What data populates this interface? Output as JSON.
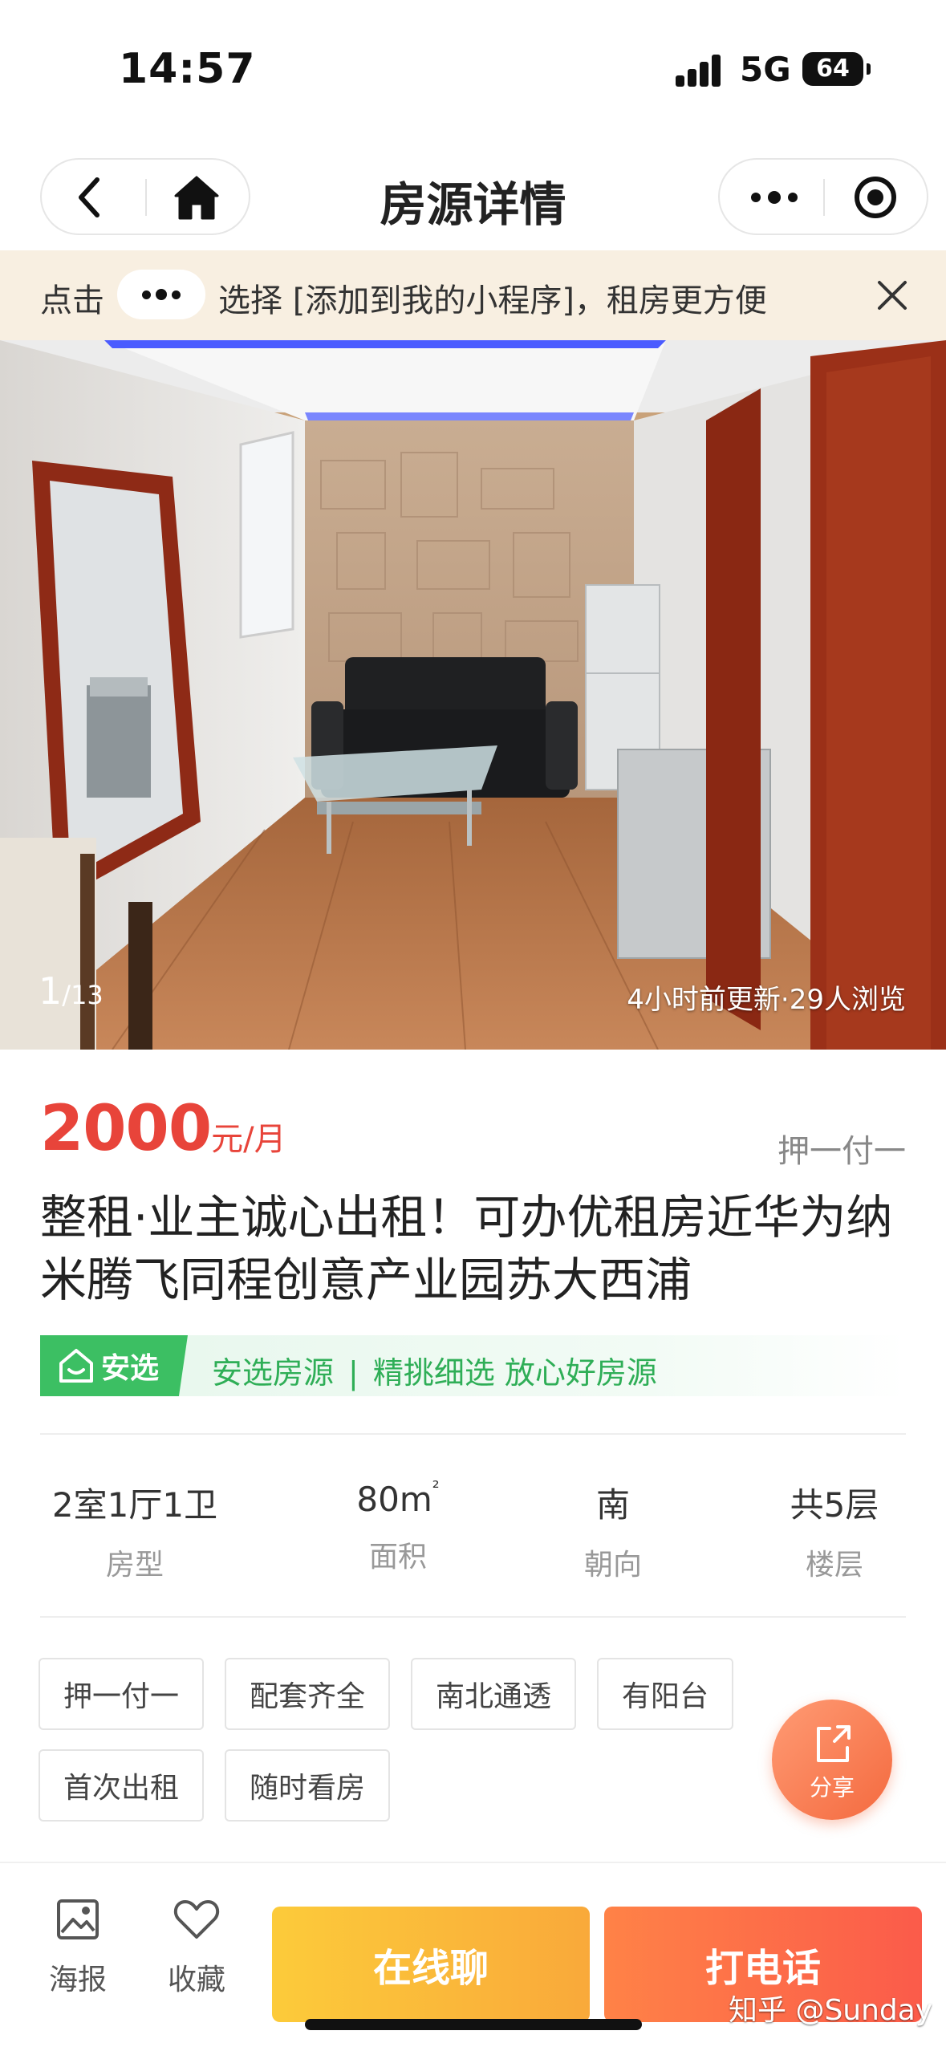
{
  "status_bar": {
    "time": "14:57",
    "network": "5G",
    "battery": "64"
  },
  "nav": {
    "title": "房源详情"
  },
  "banner": {
    "prefix": "点击",
    "suffix": "选择 [添加到我的小程序]，租房更方便"
  },
  "photo": {
    "current": "1",
    "total": "/13",
    "meta": "4小时前更新·29人浏览"
  },
  "listing": {
    "price": "2000",
    "price_unit": "元/月",
    "deposit": "押一付一",
    "title": "整租·业主诚心出租！可办优租房近华为纳米腾飞同程创意产业园苏大西浦"
  },
  "anxuan": {
    "badge": "安选",
    "text1": "安选房源",
    "separator": "|",
    "text2": "精挑细选 放心好房源"
  },
  "specs": [
    {
      "value": "2室1厅1卫",
      "label": "房型"
    },
    {
      "value": "80m",
      "sup": "²",
      "label": "面积"
    },
    {
      "value": "南",
      "label": "朝向"
    },
    {
      "value": "共5层",
      "label": "楼层"
    }
  ],
  "tags": [
    "押一付一",
    "配套齐全",
    "南北通透",
    "有阳台",
    "首次出租",
    "随时看房"
  ],
  "share": {
    "label": "分享"
  },
  "bottom": {
    "poster": "海报",
    "favorite": "收藏",
    "chat": "在线聊",
    "call": "打电话"
  },
  "watermark": "知乎 @Sunday",
  "colors": {
    "price": "#e8443a",
    "anxuan_green": "#3cbf63",
    "chat_btn": "#f9b83a",
    "call_btn": "#fb6a48"
  }
}
